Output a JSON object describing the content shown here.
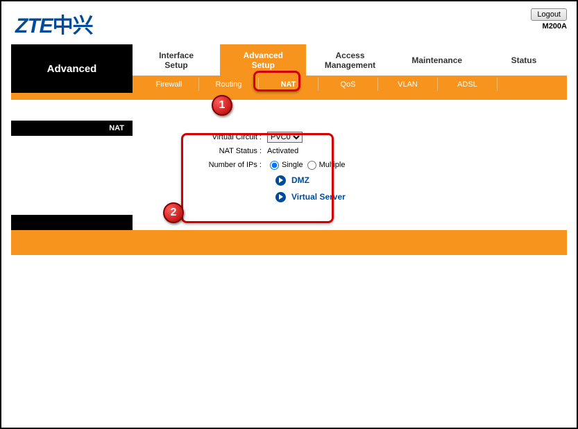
{
  "header": {
    "logo_en": "ZTE",
    "logo_cn": "中兴",
    "logout": "Logout",
    "model": "M200A"
  },
  "left_title": "Advanced",
  "main_tabs": [
    {
      "label": "Interface\nSetup",
      "active": false
    },
    {
      "label": "Advanced\nSetup",
      "active": true
    },
    {
      "label": "Access\nManagement",
      "active": false
    },
    {
      "label": "Maintenance",
      "active": false
    },
    {
      "label": "Status",
      "active": false
    }
  ],
  "sub_tabs": [
    {
      "label": "Firewall",
      "active": false
    },
    {
      "label": "Routing",
      "active": false
    },
    {
      "label": "NAT",
      "active": true
    },
    {
      "label": "QoS",
      "active": false
    },
    {
      "label": "VLAN",
      "active": false
    },
    {
      "label": "ADSL",
      "active": false
    }
  ],
  "section_title": "NAT",
  "form": {
    "vc_label": "Virtual Circuit :",
    "vc_value": "PVC0",
    "status_label": "NAT Status :",
    "status_value": "Activated",
    "ips_label": "Number of IPs :",
    "ips_single": "Single",
    "ips_multiple": "Multiple",
    "dmz": "DMZ",
    "vserver": "Virtual Server"
  },
  "callouts": {
    "one": "1",
    "two": "2"
  }
}
